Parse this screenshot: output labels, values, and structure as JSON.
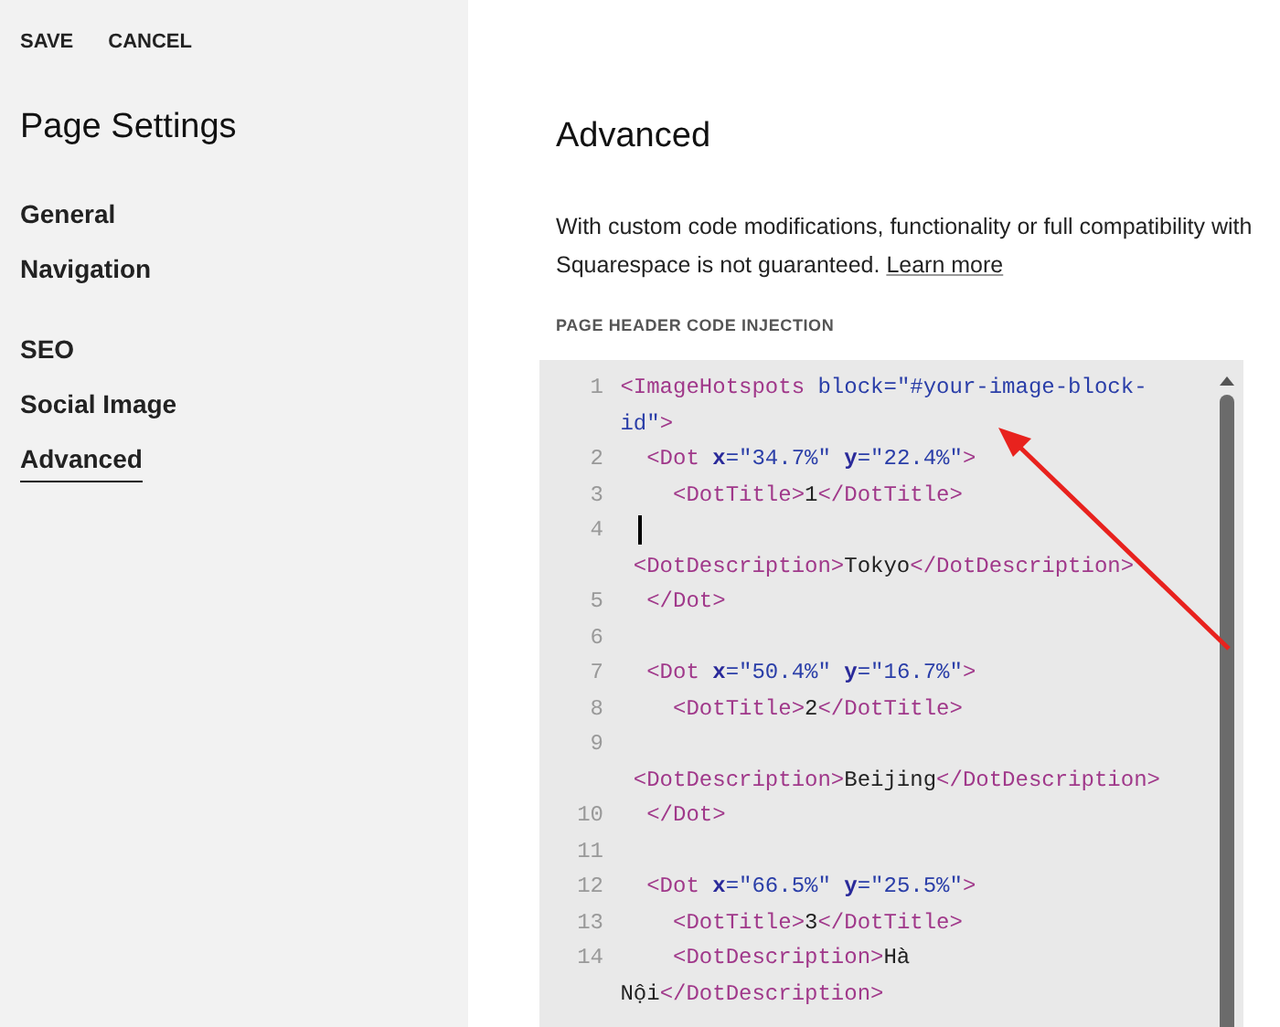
{
  "top_actions": [
    "SAVE",
    "CANCEL"
  ],
  "sidebar": {
    "title": "Page Settings",
    "groups": [
      [
        {
          "label": "General",
          "selected": false
        },
        {
          "label": "Navigation",
          "selected": false
        }
      ],
      [
        {
          "label": "SEO",
          "selected": false
        },
        {
          "label": "Social Image",
          "selected": false
        },
        {
          "label": "Advanced",
          "selected": true
        }
      ]
    ]
  },
  "main": {
    "title": "Advanced",
    "notice": "With custom code modifications, functionality or full compatibility with Squarespace is not guaranteed.",
    "notice_link": "Learn more",
    "section_label": "PAGE HEADER CODE INJECTION",
    "code_lines": [
      {
        "number": "1",
        "cursor": false,
        "rows": [
          [
            {
              "kind": "tag",
              "text": "<ImageHotspots"
            },
            {
              "kind": "plain",
              "text": " "
            },
            {
              "kind": "string",
              "text": "block=\"#your-image-block-"
            }
          ],
          [
            {
              "kind": "string",
              "text": "id\""
            },
            {
              "kind": "tag",
              "text": ">"
            }
          ]
        ]
      },
      {
        "number": "2",
        "cursor": false,
        "rows": [
          [
            {
              "kind": "plain",
              "text": "  "
            },
            {
              "kind": "tag",
              "text": "<Dot"
            },
            {
              "kind": "plain",
              "text": " "
            },
            {
              "kind": "attr",
              "text": "x"
            },
            {
              "kind": "string",
              "text": "=\"34.7%\""
            },
            {
              "kind": "plain",
              "text": " "
            },
            {
              "kind": "attr",
              "text": "y"
            },
            {
              "kind": "string",
              "text": "=\"22.4%\""
            },
            {
              "kind": "tag",
              "text": ">"
            }
          ]
        ]
      },
      {
        "number": "3",
        "cursor": false,
        "rows": [
          [
            {
              "kind": "plain",
              "text": "    "
            },
            {
              "kind": "tag",
              "text": "<DotTitle>"
            },
            {
              "kind": "plain",
              "text": "1"
            },
            {
              "kind": "tag",
              "text": "</DotTitle>"
            }
          ]
        ]
      },
      {
        "number": "4",
        "cursor": true,
        "rows": [
          [
            {
              "kind": "plain",
              "text": "   "
            }
          ],
          [
            {
              "kind": "plain",
              "text": " "
            },
            {
              "kind": "tag",
              "text": "<DotDescription>"
            },
            {
              "kind": "plain",
              "text": "Tokyo"
            },
            {
              "kind": "tag",
              "text": "</DotDescription>"
            }
          ]
        ]
      },
      {
        "number": "5",
        "cursor": false,
        "rows": [
          [
            {
              "kind": "plain",
              "text": "  "
            },
            {
              "kind": "tag",
              "text": "</Dot>"
            }
          ]
        ]
      },
      {
        "number": "6",
        "cursor": false,
        "rows": [
          []
        ]
      },
      {
        "number": "7",
        "cursor": false,
        "rows": [
          [
            {
              "kind": "plain",
              "text": "  "
            },
            {
              "kind": "tag",
              "text": "<Dot"
            },
            {
              "kind": "plain",
              "text": " "
            },
            {
              "kind": "attr",
              "text": "x"
            },
            {
              "kind": "string",
              "text": "=\"50.4%\""
            },
            {
              "kind": "plain",
              "text": " "
            },
            {
              "kind": "attr",
              "text": "y"
            },
            {
              "kind": "string",
              "text": "=\"16.7%\""
            },
            {
              "kind": "tag",
              "text": ">"
            }
          ]
        ]
      },
      {
        "number": "8",
        "cursor": false,
        "rows": [
          [
            {
              "kind": "plain",
              "text": "    "
            },
            {
              "kind": "tag",
              "text": "<DotTitle>"
            },
            {
              "kind": "plain",
              "text": "2"
            },
            {
              "kind": "tag",
              "text": "</DotTitle>"
            }
          ]
        ]
      },
      {
        "number": "9",
        "cursor": false,
        "rows": [
          [],
          [
            {
              "kind": "plain",
              "text": " "
            },
            {
              "kind": "tag",
              "text": "<DotDescription>"
            },
            {
              "kind": "plain",
              "text": "Beijing"
            },
            {
              "kind": "tag",
              "text": "</DotDescription>"
            }
          ]
        ]
      },
      {
        "number": "10",
        "cursor": false,
        "rows": [
          [
            {
              "kind": "plain",
              "text": "  "
            },
            {
              "kind": "tag",
              "text": "</Dot>"
            }
          ]
        ]
      },
      {
        "number": "11",
        "cursor": false,
        "rows": [
          []
        ]
      },
      {
        "number": "12",
        "cursor": false,
        "rows": [
          [
            {
              "kind": "plain",
              "text": "  "
            },
            {
              "kind": "tag",
              "text": "<Dot"
            },
            {
              "kind": "plain",
              "text": " "
            },
            {
              "kind": "attr",
              "text": "x"
            },
            {
              "kind": "string",
              "text": "=\"66.5%\""
            },
            {
              "kind": "plain",
              "text": " "
            },
            {
              "kind": "attr",
              "text": "y"
            },
            {
              "kind": "string",
              "text": "=\"25.5%\""
            },
            {
              "kind": "tag",
              "text": ">"
            }
          ]
        ]
      },
      {
        "number": "13",
        "cursor": false,
        "rows": [
          [
            {
              "kind": "plain",
              "text": "    "
            },
            {
              "kind": "tag",
              "text": "<DotTitle>"
            },
            {
              "kind": "plain",
              "text": "3"
            },
            {
              "kind": "tag",
              "text": "</DotTitle>"
            }
          ]
        ]
      },
      {
        "number": "14",
        "cursor": false,
        "rows": [
          [
            {
              "kind": "plain",
              "text": "    "
            },
            {
              "kind": "tag",
              "text": "<DotDescription>"
            },
            {
              "kind": "plain",
              "text": "Hà"
            }
          ],
          [
            {
              "kind": "plain",
              "text": "Nội"
            },
            {
              "kind": "tag",
              "text": "</DotDescription>"
            }
          ]
        ]
      }
    ]
  }
}
